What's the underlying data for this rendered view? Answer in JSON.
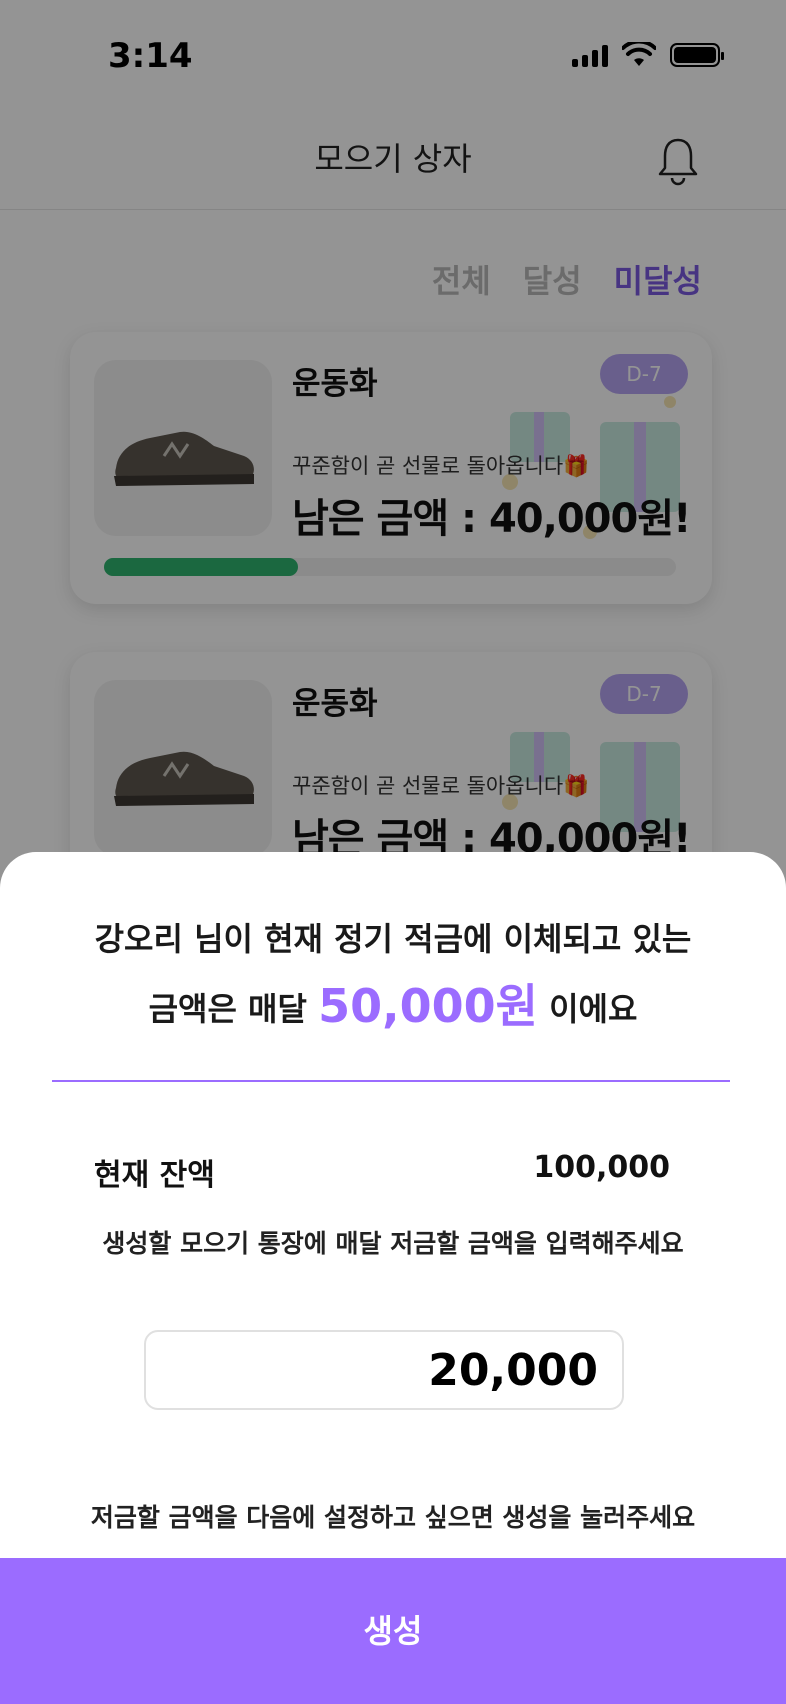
{
  "status_bar": {
    "time": "3:14"
  },
  "header": {
    "title": "모으기 상자",
    "bell_icon": "bell-icon"
  },
  "filter_tabs": [
    {
      "label": "전체",
      "active": false
    },
    {
      "label": "달성",
      "active": false
    },
    {
      "label": "미달성",
      "active": true
    }
  ],
  "cards": [
    {
      "title": "운동화",
      "badge": "D-7",
      "subtitle": "꾸준함이 곧 선물로 돌아옵니다🎁",
      "amount": "남은 금액 :  40,000원!",
      "progress": 0.34
    },
    {
      "title": "운동화",
      "badge": "D-7",
      "subtitle": "꾸준함이 곧 선물로 돌아옵니다🎁",
      "amount": "남은 금액 :  40,000원!",
      "progress": 0.34
    }
  ],
  "sheet": {
    "line1": "강오리 님이 현재 정기 적금에 이체되고 있는",
    "line2_prefix": "금액은 매달",
    "line2_amount": "50,000원",
    "line2_suffix": "이에요",
    "balance_label": "현재 잔액",
    "balance_value": "100,000",
    "instruction": "생성할 모으기 통장에 매달 저금할 금액을 입력해주세요",
    "input_value": "20,000",
    "hint": "저금할 금액을 다음에 설정하고 싶으면 생성을 눌러주세요",
    "create_button": "생성"
  },
  "colors": {
    "accent": "#9b6cff",
    "tab_active": "#7a5ae0",
    "progress": "#2fb36f",
    "badge": "#b5a4f2"
  }
}
